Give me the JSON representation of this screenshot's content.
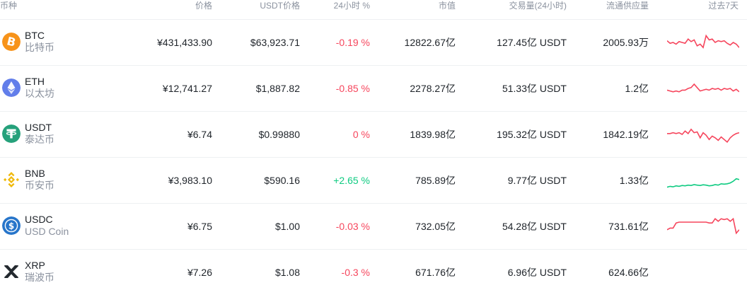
{
  "header": {
    "coin": "币种",
    "price": "价格",
    "usdt_price": "USDT价格",
    "change": "24小时 %",
    "market_cap": "市值",
    "volume": "交易量(24小时)",
    "supply": "流通供应量",
    "chart": "过去7天"
  },
  "colors": {
    "negative": "#f6465d",
    "positive": "#0ecb81"
  },
  "rows": [
    {
      "symbol": "BTC",
      "name": "比特币",
      "icon": "bitcoin-icon",
      "price": "¥431,433.90",
      "usdt_price": "$63,923.71",
      "change": "-0.19 %",
      "market_cap": "12822.67亿",
      "volume": "127.45亿 USDT",
      "supply": "2005.93万",
      "spark": [
        0.6,
        0.45,
        0.5,
        0.4,
        0.55,
        0.5,
        0.45,
        0.7,
        0.55,
        0.65,
        0.3,
        0.4,
        0.2,
        0.9,
        0.65,
        0.7,
        0.5,
        0.6,
        0.55,
        0.6,
        0.45,
        0.35,
        0.5,
        0.4,
        0.2
      ]
    },
    {
      "symbol": "ETH",
      "name": "以太坊",
      "icon": "ethereum-icon",
      "price": "¥12,741.27",
      "usdt_price": "$1,887.82",
      "change": "-0.85 %",
      "market_cap": "2278.27亿",
      "volume": "51.33亿 USDT",
      "supply": "1.2亿",
      "spark": [
        0.4,
        0.35,
        0.3,
        0.35,
        0.3,
        0.4,
        0.4,
        0.5,
        0.55,
        0.75,
        0.55,
        0.35,
        0.4,
        0.45,
        0.4,
        0.5,
        0.45,
        0.5,
        0.4,
        0.5,
        0.45,
        0.5,
        0.35,
        0.45,
        0.3
      ]
    },
    {
      "symbol": "USDT",
      "name": "泰达币",
      "icon": "tether-icon",
      "price": "¥6.74",
      "usdt_price": "$0.99880",
      "change": "0 %",
      "market_cap": "1839.98亿",
      "volume": "195.32亿 USDT",
      "supply": "1842.19亿",
      "spark": [
        0.55,
        0.55,
        0.6,
        0.55,
        0.6,
        0.5,
        0.7,
        0.55,
        0.8,
        0.6,
        0.65,
        0.3,
        0.6,
        0.45,
        0.2,
        0.4,
        0.3,
        0.15,
        0.35,
        0.2,
        0.05,
        0.3,
        0.45,
        0.55,
        0.6
      ]
    },
    {
      "symbol": "BNB",
      "name": "币安币",
      "icon": "binance-icon",
      "price": "¥3,983.10",
      "usdt_price": "$590.16",
      "change": "+2.65 %",
      "market_cap": "785.89亿",
      "volume": "9.77亿 USDT",
      "supply": "1.33亿",
      "spark": [
        0.1,
        0.15,
        0.12,
        0.18,
        0.15,
        0.2,
        0.18,
        0.22,
        0.2,
        0.25,
        0.22,
        0.2,
        0.24,
        0.22,
        0.18,
        0.2,
        0.25,
        0.22,
        0.3,
        0.28,
        0.3,
        0.35,
        0.45,
        0.6,
        0.55
      ]
    },
    {
      "symbol": "USDC",
      "name": "USD Coin",
      "icon": "usd-coin-icon",
      "price": "¥6.75",
      "usdt_price": "$1.00",
      "change": "-0.03 %",
      "market_cap": "732.05亿",
      "volume": "54.28亿 USDT",
      "supply": "731.61亿",
      "spark": [
        0.3,
        0.4,
        0.4,
        0.7,
        0.75,
        0.75,
        0.75,
        0.75,
        0.75,
        0.75,
        0.75,
        0.75,
        0.75,
        0.75,
        0.7,
        0.7,
        0.95,
        0.8,
        0.95,
        0.9,
        0.95,
        0.8,
        0.95,
        0.1,
        0.3
      ]
    },
    {
      "symbol": "XRP",
      "name": "瑞波币",
      "icon": "xrp-icon",
      "price": "¥7.26",
      "usdt_price": "$1.08",
      "change": "-0.3 %",
      "market_cap": "671.76亿",
      "volume": "6.96亿 USDT",
      "supply": "624.66亿",
      "spark": []
    }
  ]
}
